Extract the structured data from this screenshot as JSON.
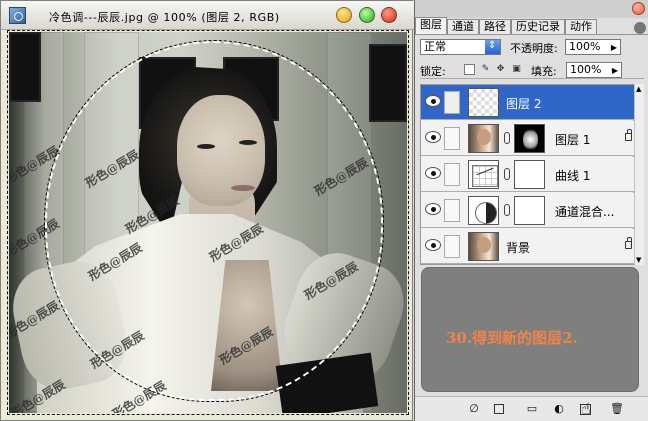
{
  "document": {
    "title": "冷色调---辰辰.jpg @ 100% (图层 2, RGB)",
    "watermark": "形色@辰辰"
  },
  "panel": {
    "tabs": [
      "图层",
      "通道",
      "路径",
      "历史记录",
      "动作"
    ],
    "blend_mode": "正常",
    "opacity_label": "不透明度:",
    "opacity_value": "100%",
    "lock_label": "锁定:",
    "fill_label": "填充:",
    "fill_value": "100%",
    "layers": [
      {
        "name": "图层 2"
      },
      {
        "name": "图层 1"
      },
      {
        "name": "曲线 1"
      },
      {
        "name": "通道混合..."
      },
      {
        "name": "背景"
      }
    ],
    "message": "30.得到新的图层2."
  }
}
